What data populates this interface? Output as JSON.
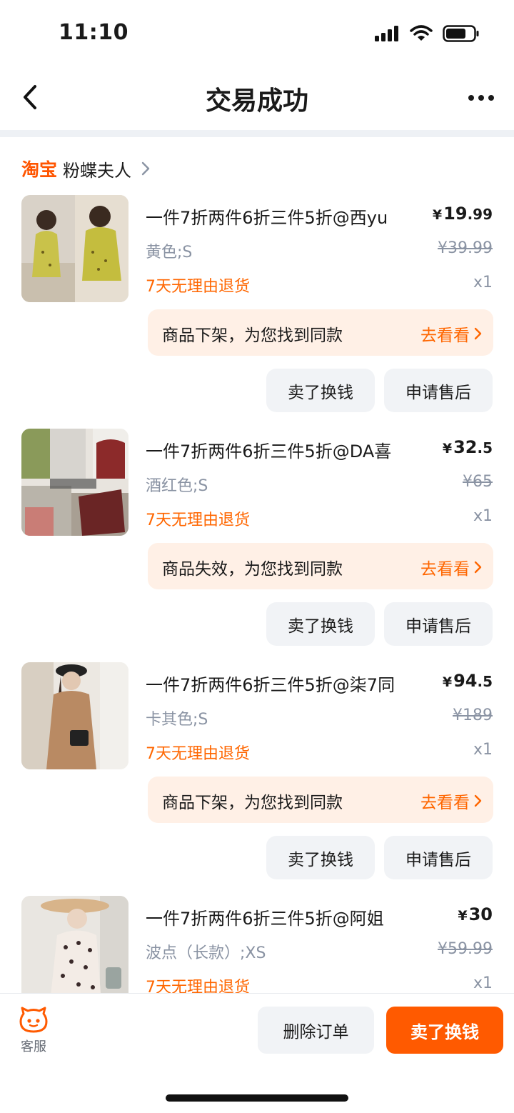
{
  "status_bar": {
    "time": "11:10"
  },
  "nav": {
    "title": "交易成功"
  },
  "shop": {
    "platform": "淘宝",
    "name": "粉蝶夫人"
  },
  "items": [
    {
      "title": "一件7折两件6折三件5折@西yu",
      "price_yen": "¥",
      "price_int": "19",
      "price_dec": ".99",
      "sku": "黄色;S",
      "original_price": "¥39.99",
      "tag": "7天无理由退货",
      "qty": "x1",
      "notice": "商品下架，为您找到同款",
      "notice_link": "去看看",
      "btn_sell": "卖了换钱",
      "btn_aftersale": "申请售后"
    },
    {
      "title": "一件7折两件6折三件5折@DA喜",
      "price_yen": "¥",
      "price_int": "32",
      "price_dec": ".5",
      "sku": "酒红色;S",
      "original_price": "¥65",
      "tag": "7天无理由退货",
      "qty": "x1",
      "notice": "商品失效，为您找到同款",
      "notice_link": "去看看",
      "btn_sell": "卖了换钱",
      "btn_aftersale": "申请售后"
    },
    {
      "title": "一件7折两件6折三件5折@柒7同",
      "price_yen": "¥",
      "price_int": "94",
      "price_dec": ".5",
      "sku": "卡其色;S",
      "original_price": "¥189",
      "tag": "7天无理由退货",
      "qty": "x1",
      "notice": "商品下架，为您找到同款",
      "notice_link": "去看看",
      "btn_sell": "卖了换钱",
      "btn_aftersale": "申请售后"
    },
    {
      "title": "一件7折两件6折三件5折@阿姐",
      "price_yen": "¥",
      "price_int": "30",
      "price_dec": "",
      "sku": "波点（长款）;XS",
      "original_price": "¥59.99",
      "tag": "7天无理由退货",
      "qty": "x1"
    }
  ],
  "bottom_bar": {
    "customer_service": "客服",
    "delete_order": "删除订单",
    "sell": "卖了换钱"
  },
  "colors": {
    "accent": "#ff5a00",
    "notice_bg": "#fff0e6",
    "muted": "#8a93a3"
  }
}
